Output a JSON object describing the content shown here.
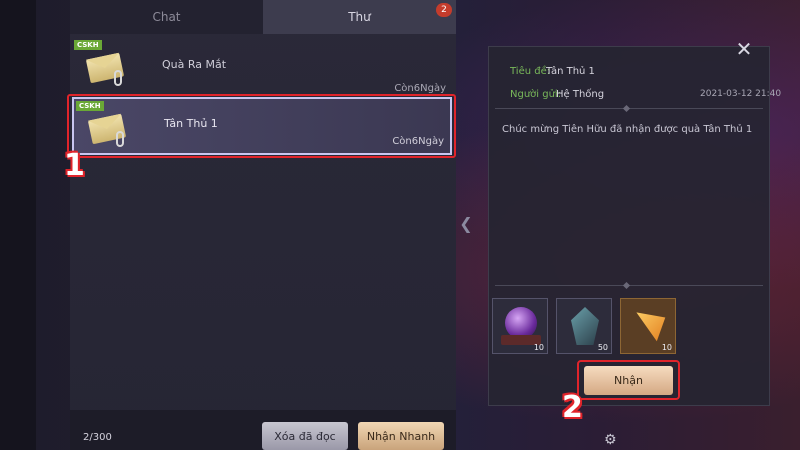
{
  "tabs": {
    "chat": "Chat",
    "mail": "Thư",
    "mail_badge": "2"
  },
  "mail_list": [
    {
      "tag": "CSKH",
      "title": "Quà Ra Mắt",
      "expire": "Còn6Ngày"
    },
    {
      "tag": "CSKH",
      "title": "Tân Thủ 1",
      "expire": "Còn6Ngày"
    }
  ],
  "footer": {
    "count": "2/300",
    "delete_read": "Xóa đã đọc",
    "quick_claim": "Nhận Nhanh"
  },
  "detail": {
    "title_label": "Tiêu đề:",
    "title_value": "Tân Thủ 1",
    "sender_label": "Người gửi:",
    "sender_value": "Hệ Thống",
    "date": "2021-03-12 21:40",
    "body": "Chúc mừng Tiên Hữu đã nhận được quà Tân Thủ 1",
    "rewards": [
      {
        "icon": "orb-icon",
        "count": "10"
      },
      {
        "icon": "stone-icon",
        "count": "50"
      },
      {
        "icon": "amulet-icon",
        "count": "10"
      }
    ],
    "claim": "Nhận"
  },
  "annotations": {
    "step1": "1",
    "step2": "2"
  },
  "colors": {
    "accent_red": "#e0242b",
    "label_green": "#79b85a",
    "selected_border": "#c9c6f0"
  }
}
